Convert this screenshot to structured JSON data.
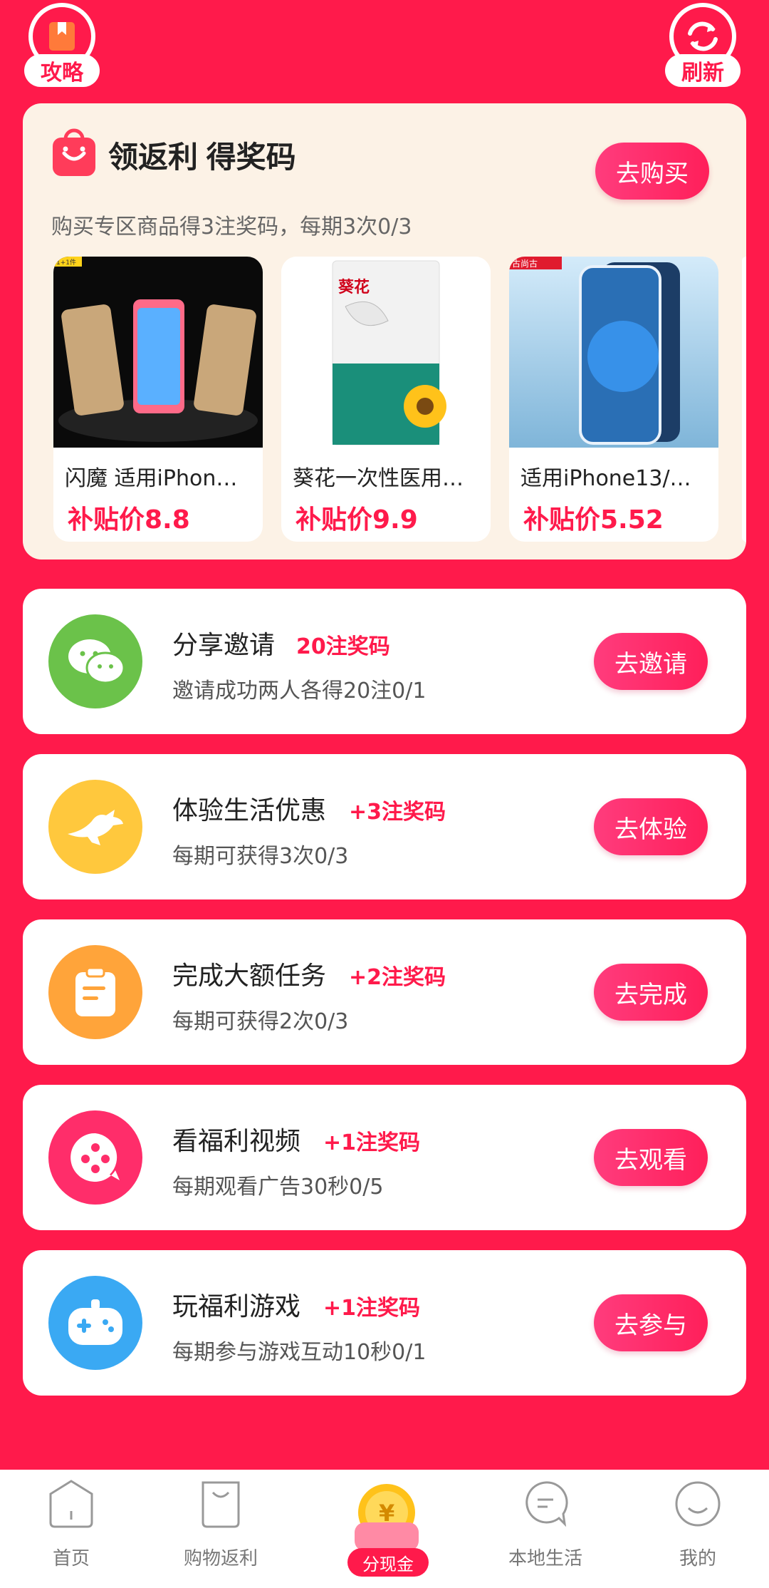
{
  "top": {
    "guide_label": "攻略",
    "refresh_label": "刷新"
  },
  "shop": {
    "title": "领返利 得奖码",
    "subtitle": "购买专区商品得3注奖码，每期3次0/3",
    "button": "去购买",
    "products": [
      {
        "name": "闪魔 适用iPhon…",
        "price": "补贴价8.8",
        "brand_tag": "1+1件"
      },
      {
        "name": "葵花一次性医用…",
        "price": "补贴价9.9",
        "brand_tag": "葵花"
      },
      {
        "name": "适用iPhone13/…",
        "price": "补贴价5.52",
        "brand_tag": "古尚古"
      }
    ]
  },
  "tasks": [
    {
      "title": "分享邀请",
      "reward": "20注奖码",
      "desc": "邀请成功两人各得20注0/1",
      "button": "去邀请",
      "icon": "wechat-icon",
      "color": "#6bc24a"
    },
    {
      "title": "体验生活优惠",
      "reward": "+3注奖码",
      "desc": "每期可获得3次0/3",
      "button": "去体验",
      "icon": "kangaroo-icon",
      "color": "#ffc83d"
    },
    {
      "title": "完成大额任务",
      "reward": "+2注奖码",
      "desc": "每期可获得2次0/3",
      "button": "去完成",
      "icon": "clipboard-icon",
      "color": "#ffa43a"
    },
    {
      "title": "看福利视频",
      "reward": "+1注奖码",
      "desc": "每期观看广告30秒0/5",
      "button": "去观看",
      "icon": "video-icon",
      "color": "#ff2d6a"
    },
    {
      "title": "玩福利游戏",
      "reward": "+1注奖码",
      "desc": "每期参与游戏互动10秒0/1",
      "button": "去参与",
      "icon": "gamepad-icon",
      "color": "#3aa9f3"
    }
  ],
  "nav": {
    "home": "首页",
    "shopping": "购物返利",
    "cash": "分现金",
    "local": "本地生活",
    "mine": "我的"
  },
  "colors": {
    "brand": "#ff1a4b",
    "card_bg": "#fcf2e6"
  }
}
